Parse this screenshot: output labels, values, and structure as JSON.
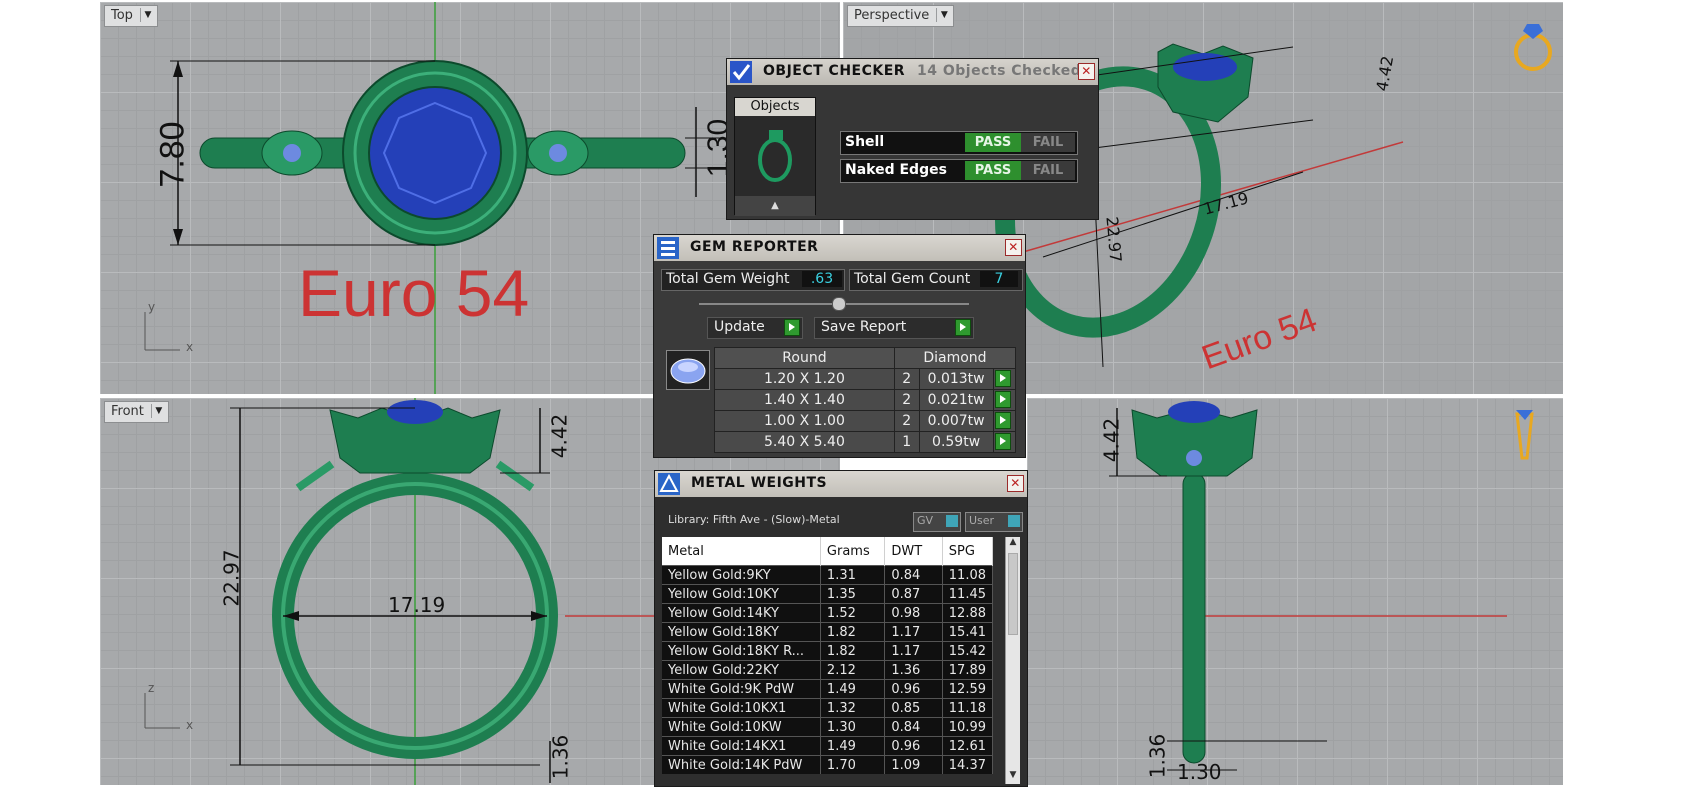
{
  "viewports": {
    "top": {
      "label": "Top",
      "size_label": "Euro 54",
      "dims": [
        "7.80",
        "1.30"
      ],
      "axes": [
        "y",
        "x"
      ]
    },
    "perspective": {
      "label": "Perspective",
      "size_label": "Euro 54",
      "dims": [
        "4.42",
        "17.19",
        "22.97"
      ]
    },
    "front": {
      "label": "Front",
      "dims": [
        "4.42",
        "22.97",
        "17.19",
        "1.36"
      ],
      "axes": [
        "z",
        "x"
      ]
    },
    "right": {
      "dims": [
        "4.42",
        "1.36",
        "1.30"
      ]
    }
  },
  "object_checker": {
    "title": "OBJECT CHECKER",
    "objects_checked": "14  Objects Checked",
    "objects_tab": "Objects",
    "checks": [
      {
        "name": "Shell",
        "pass": "PASS",
        "fail": "FAIL"
      },
      {
        "name": "Naked Edges",
        "pass": "PASS",
        "fail": "FAIL"
      }
    ]
  },
  "gem_reporter": {
    "title": "GEM REPORTER",
    "total_weight_label": "Total Gem Weight",
    "total_weight": ".63",
    "total_count_label": "Total Gem Count",
    "total_count": "7",
    "update_label": "Update",
    "save_label": "Save Report",
    "shape": "Round",
    "material": "Diamond",
    "rows": [
      {
        "size": "1.20 X 1.20",
        "count": "2",
        "weight": "0.013tw"
      },
      {
        "size": "1.40 X 1.40",
        "count": "2",
        "weight": "0.021tw"
      },
      {
        "size": "1.00 X 1.00",
        "count": "2",
        "weight": "0.007tw"
      },
      {
        "size": "5.40 X 5.40",
        "count": "1",
        "weight": "0.59tw"
      }
    ]
  },
  "metal_weights": {
    "title": "METAL WEIGHTS",
    "library": "Library: Fifth Ave - (Slow)-Metal",
    "gv_label": "GV",
    "user_label": "User",
    "columns": [
      "Metal",
      "Grams",
      "DWT",
      "SPG"
    ],
    "rows": [
      [
        "Yellow Gold:9KY",
        "1.31",
        "0.84",
        "11.08"
      ],
      [
        "Yellow Gold:10KY",
        "1.35",
        "0.87",
        "11.45"
      ],
      [
        "Yellow Gold:14KY",
        "1.52",
        "0.98",
        "12.88"
      ],
      [
        "Yellow Gold:18KY",
        "1.82",
        "1.17",
        "15.41"
      ],
      [
        "Yellow Gold:18KY R...",
        "1.82",
        "1.17",
        "15.42"
      ],
      [
        "Yellow Gold:22KY",
        "2.12",
        "1.36",
        "17.89"
      ],
      [
        "White Gold:9K PdW",
        "1.49",
        "0.96",
        "12.59"
      ],
      [
        "White Gold:10KX1",
        "1.32",
        "0.85",
        "11.18"
      ],
      [
        "White Gold:10KW",
        "1.30",
        "0.84",
        "10.99"
      ],
      [
        "White Gold:14KX1",
        "1.49",
        "0.96",
        "12.61"
      ],
      [
        "White Gold:14K PdW",
        "1.70",
        "1.09",
        "14.37"
      ]
    ]
  },
  "colors": {
    "ring": "#1f8a5a",
    "gem": "#2a48c8",
    "label_red": "#cc3333",
    "pass_green": "#2e8f2e"
  }
}
